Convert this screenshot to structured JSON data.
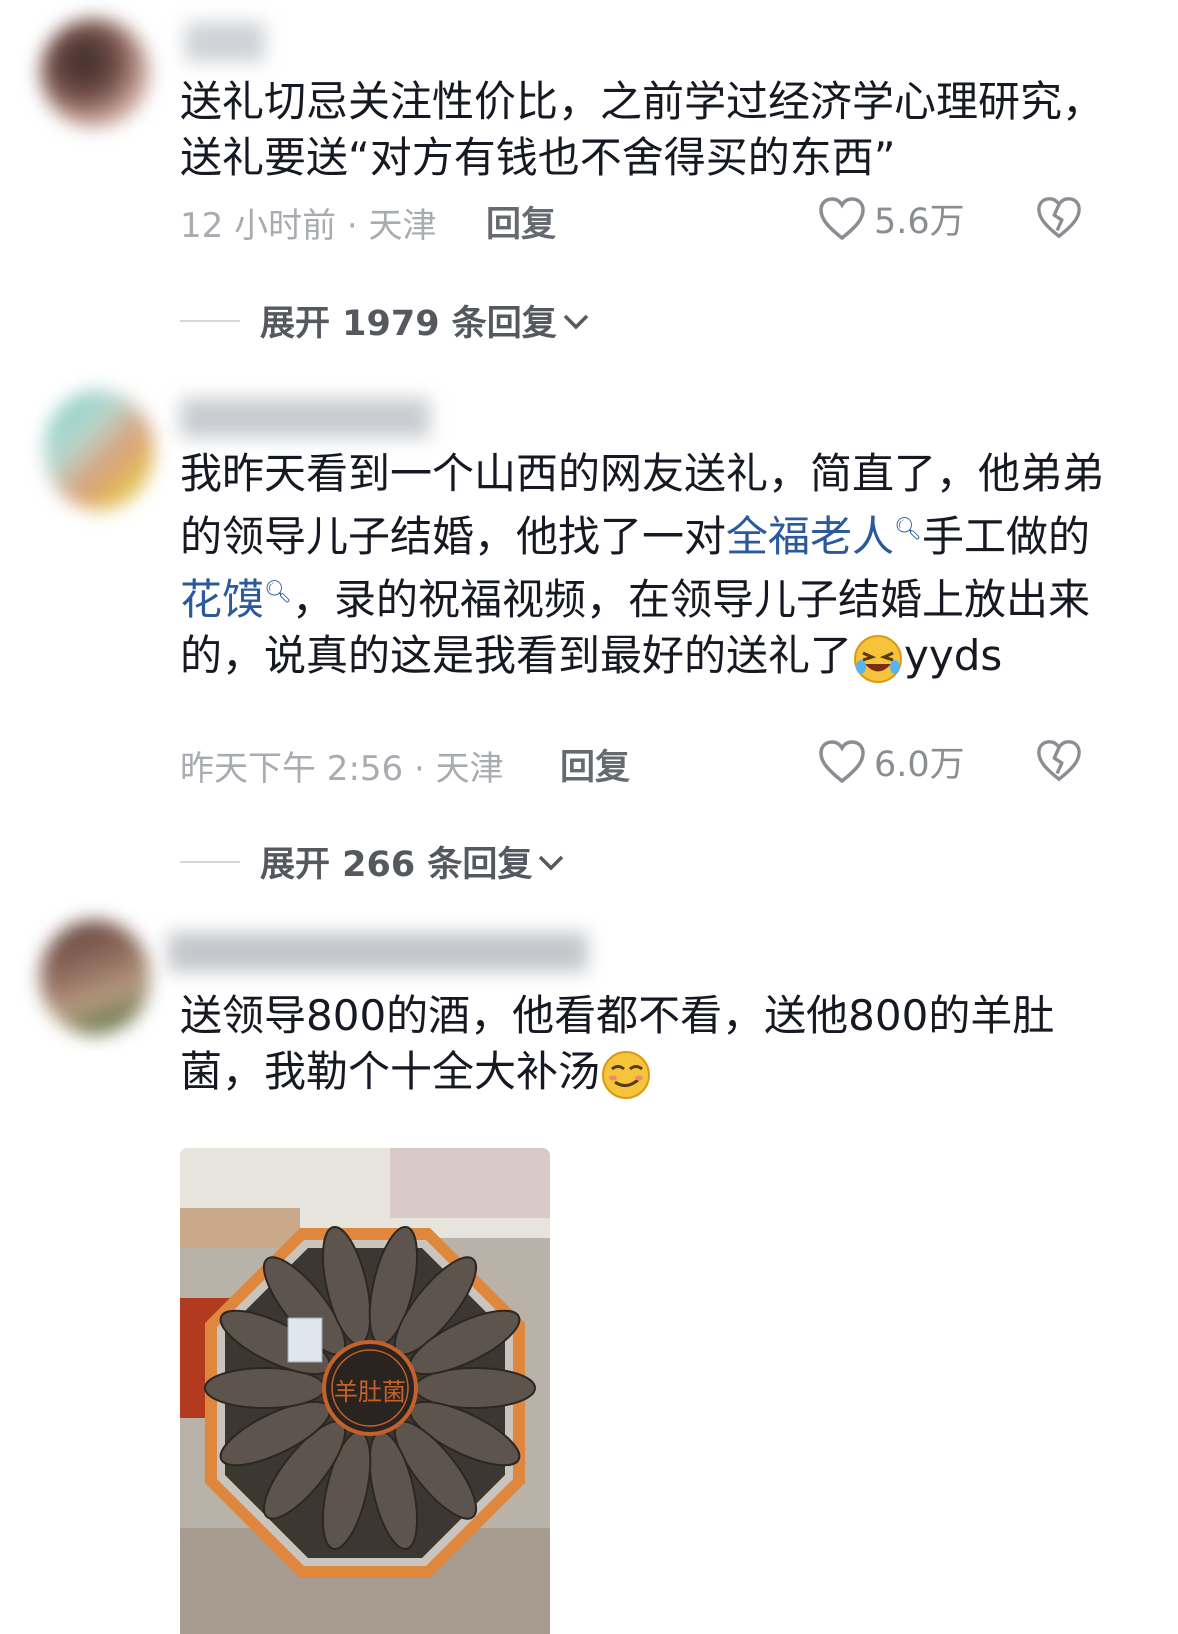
{
  "comments": [
    {
      "text": "送礼切忌关注性价比，之前学过经济学心理研究，送礼要送“对方有钱也不舍得买的东西”",
      "time_location": "12 小时前 · 天津",
      "reply_label": "回复",
      "likes": "5.6万",
      "expand_label": "展开 1979 条回复"
    },
    {
      "text_part1": "我昨天看到一个山西的网友送礼，简直了，他弟弟的领导儿子结婚，他找了一对",
      "link1": "全福老人",
      "text_part2": "手工做的",
      "link2": "花馍",
      "text_part3": "，录的祝福视频，在领导儿子结婚上放出来的，说真的这是我看到最好的送礼了",
      "text_part4": "yyds",
      "time_location": "昨天下午 2:56 · 天津",
      "reply_label": "回复",
      "likes": "6.0万",
      "expand_label": "展开 266 条回复"
    },
    {
      "text": "送领导800的酒，他看都不看，送他800的羊肚菌，我勒个十全大补汤",
      "image_stamp": "羊肚菌"
    }
  ],
  "colors": {
    "link": "#2a5a9a",
    "meta": "#a8abb0",
    "text": "#161823"
  },
  "icons": [
    "heart-outline-icon",
    "broken-heart-icon",
    "chevron-down-icon",
    "search-icon",
    "laughing-emoji",
    "smirk-emoji"
  ]
}
